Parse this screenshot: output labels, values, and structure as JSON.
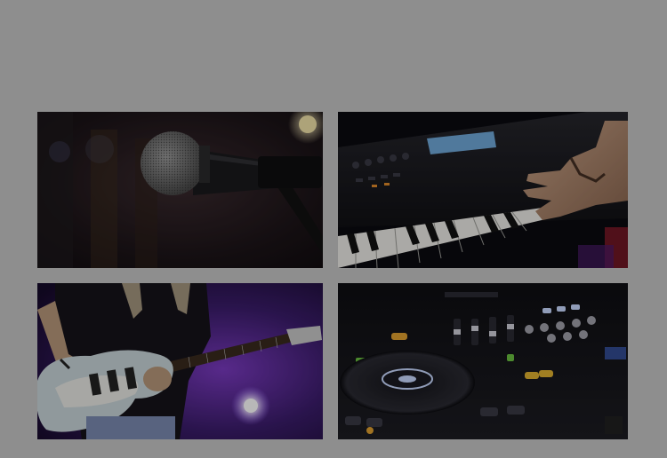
{
  "gallery": {
    "items": [
      {
        "icon": "microphone-icon"
      },
      {
        "icon": "keyboard-icon"
      },
      {
        "icon": "guitar-icon"
      },
      {
        "icon": "dj-controller-icon"
      }
    ]
  },
  "colors": {
    "page_background": "#8e8e8e",
    "stage_purple": "#5a2a9a",
    "stage_blue": "#2a3a7a"
  }
}
